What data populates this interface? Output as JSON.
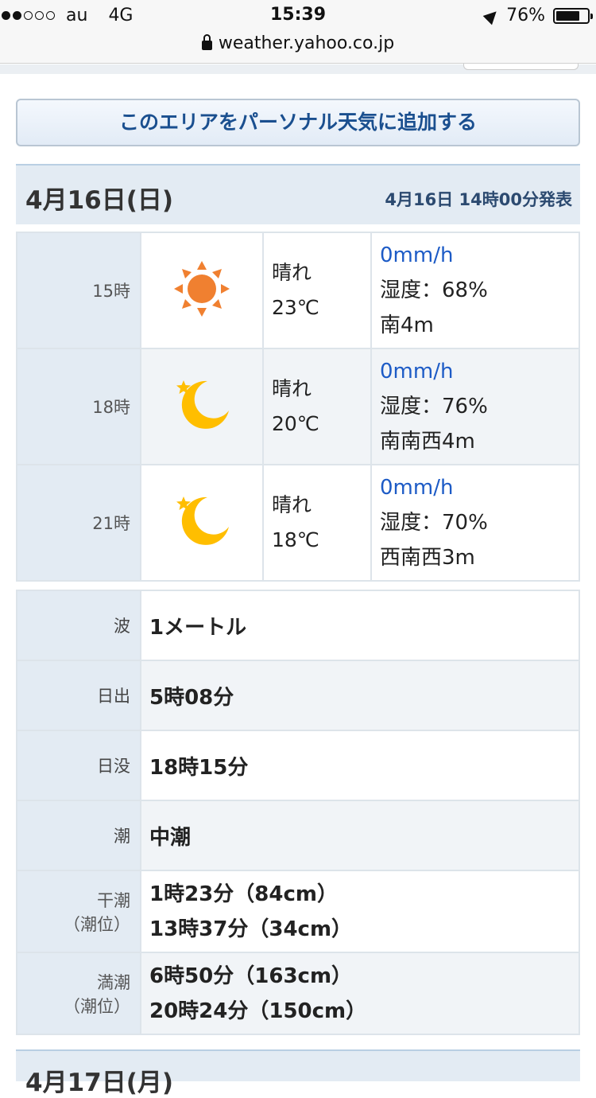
{
  "status": {
    "carrier": "au",
    "network": "4G",
    "time": "15:39",
    "battery": "76%",
    "battery_level": 0.76,
    "signal_bars": 2,
    "signal_total": 5
  },
  "url": "weather.yahoo.co.jp",
  "add_button": "このエリアをパーソナル天気に追加する",
  "day": {
    "date": "4月16日(日)",
    "announced": "4月16日 14時00分発表"
  },
  "forecast": [
    {
      "hour": "15時",
      "icon": "sun-icon",
      "weather": "晴れ",
      "temp": "23℃",
      "rain": "0mm/h",
      "humidity": "湿度：68%",
      "wind": "南4m"
    },
    {
      "hour": "18時",
      "icon": "moon-icon",
      "weather": "晴れ",
      "temp": "20℃",
      "rain": "0mm/h",
      "humidity": "湿度：76%",
      "wind": "南南西4m"
    },
    {
      "hour": "21時",
      "icon": "moon-icon",
      "weather": "晴れ",
      "temp": "18℃",
      "rain": "0mm/h",
      "humidity": "湿度：70%",
      "wind": "西南西3m"
    }
  ],
  "info": {
    "wave_label": "波",
    "wave": "1メートル",
    "sunrise_label": "日出",
    "sunrise": "5時08分",
    "sunset_label": "日没",
    "sunset": "18時15分",
    "tide_label": "潮",
    "tide": "中潮",
    "low_tide_label": "干潮",
    "low_tide_sub": "（潮位）",
    "low_tide_1": "1時23分（84cm）",
    "low_tide_2": "13時37分（34cm）",
    "high_tide_label": "満潮",
    "high_tide_sub": "（潮位）",
    "high_tide_1": "6時50分（163cm）",
    "high_tide_2": "20時24分（150cm）"
  },
  "next_day": {
    "date": "4月17日(月)"
  },
  "colors": {
    "sun": "#f08030",
    "moon": "#ffbe00",
    "link_blue": "#1d5bc6",
    "header_bg": "#e3ebf3"
  }
}
